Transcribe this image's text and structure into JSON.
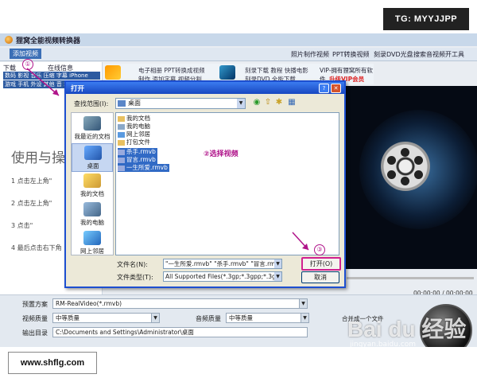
{
  "watermarks": {
    "top": "TG: MYYJJPP",
    "bottom": "www.shflg.com",
    "baidu": "Bai du 经验",
    "baidu_url": "jingyan.baidu.com"
  },
  "app": {
    "title": "狸窝全能视频转换器",
    "add_video": "添加视频",
    "top_menu": [
      "照片制作视频",
      "PPT转换视频",
      "刻录DVD光盘",
      "搜索音视频开工具"
    ],
    "left_tabs_row1": [
      "下载",
      "画面",
      "在线信息"
    ],
    "left_tabs_row2": "数码 影视 音乐 压缩 字幕 iPhone",
    "left_tabs_row3": "游戏 手机 外设 其他 音 5 M",
    "heading": "使用与操",
    "steps": [
      "1 点击左上角\"",
      "2 点击左上角\"",
      "3 点击\"",
      "4 最后点击右下角"
    ],
    "promo": {
      "p1": "电子相册  PPT转换成视频",
      "p2": "制作  添加字幕  视频分割",
      "p3": "刻录下载  教程  快播电影",
      "p4": "刻录DVD  全能下载",
      "vip1": "VIP-拥有狸窝所有软件",
      "vip2": "升级VIP会员"
    },
    "time_display": "00:00:00 / 00:00:00",
    "bottom": {
      "preset_label": "预置方案",
      "preset_value": "RM-RealVideo(*.rmvb)",
      "vquality_label": "视频质量",
      "vquality_value": "中等质量",
      "aquality_label": "音频质量",
      "aquality_value": "中等质量",
      "output_label": "输出目录",
      "output_value": "C:\\Documents and Settings\\Administrator\\桌面",
      "merge_label": "合并成一个文件"
    }
  },
  "dialog": {
    "title": "打开",
    "look_in_label": "查找范围(I):",
    "look_in_value": "桌面",
    "places": [
      "我最近的文档",
      "桌面",
      "我的文档",
      "我的电脑",
      "网上邻居"
    ],
    "files": [
      "我的文档",
      "我的电脑",
      "网上邻居",
      "打包文件",
      "杀手.rmvb",
      "冒言.rmvb",
      "一生所爱.rmvb"
    ],
    "annotation": "②选择视频",
    "filename_label": "文件名(N):",
    "filename_value": "\"一生所爱.rmvb\" \"杀手.rmvb\" \"冒言.rmvb\"",
    "filetype_label": "文件类型(T):",
    "filetype_value": "All Supported Files(*.3gp;*.3gpp;*.3g",
    "open_button": "打开(O)",
    "cancel_button": "取消",
    "step_markers": [
      "①",
      "③"
    ]
  },
  "colors": {
    "accent": "#1d4fd0",
    "annotation": "#b0148a",
    "selection": "#316ac5"
  }
}
